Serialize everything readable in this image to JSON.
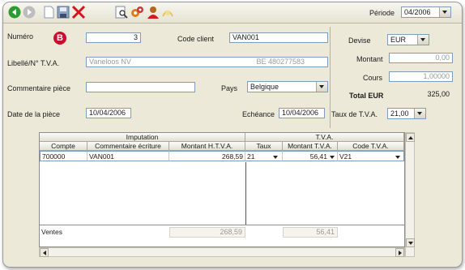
{
  "toolbar": {
    "periode_label": "Période",
    "periode_value": "04/2006"
  },
  "form": {
    "badge": "B",
    "numero_label": "Numéro",
    "numero_value": "3",
    "code_client_label": "Code client",
    "code_client_value": "VAN001",
    "libelle_label": "Libellé/N° T.V.A.",
    "libelle_value": "Vaneloos NV",
    "tva_number": "BE 480277583",
    "commentaire_label": "Commentaire pièce",
    "commentaire_value": "",
    "pays_label": "Pays",
    "pays_value": "Belgique",
    "date_label": "Date de la pièce",
    "date_value": "10/04/2006",
    "echeance_label": "Echéance",
    "echeance_value": "10/04/2006",
    "devise_label": "Devise",
    "devise_value": "EUR",
    "montant_label": "Montant",
    "montant_value": "0,00",
    "cours_label": "Cours",
    "cours_value": "1,00000",
    "total_label": "Total EUR",
    "total_value": "325,00",
    "taux_label": "Taux de T.V.A.",
    "taux_value": "21,00"
  },
  "grid": {
    "group_imputation": "Imputation",
    "group_tva": "T.V.A.",
    "columns": {
      "compte": "Compte",
      "commentaire": "Commentaire écriture",
      "montant_htva": "Montant H.T.V.A.",
      "taux": "Taux",
      "montant_tva": "Montant T.V.A.",
      "code_tva": "Code T.V.A."
    },
    "row": {
      "compte": "700000",
      "commentaire": "VAN001",
      "montant_htva": "268,59",
      "taux": "21",
      "montant_tva": "56,41",
      "code_tva": "V21"
    },
    "footer": {
      "label": "Ventes",
      "total_htva": "268,59",
      "total_tva": "56,41"
    }
  },
  "colors": {
    "accent_red": "#c8102e",
    "window_bg": "#ece9d8"
  }
}
